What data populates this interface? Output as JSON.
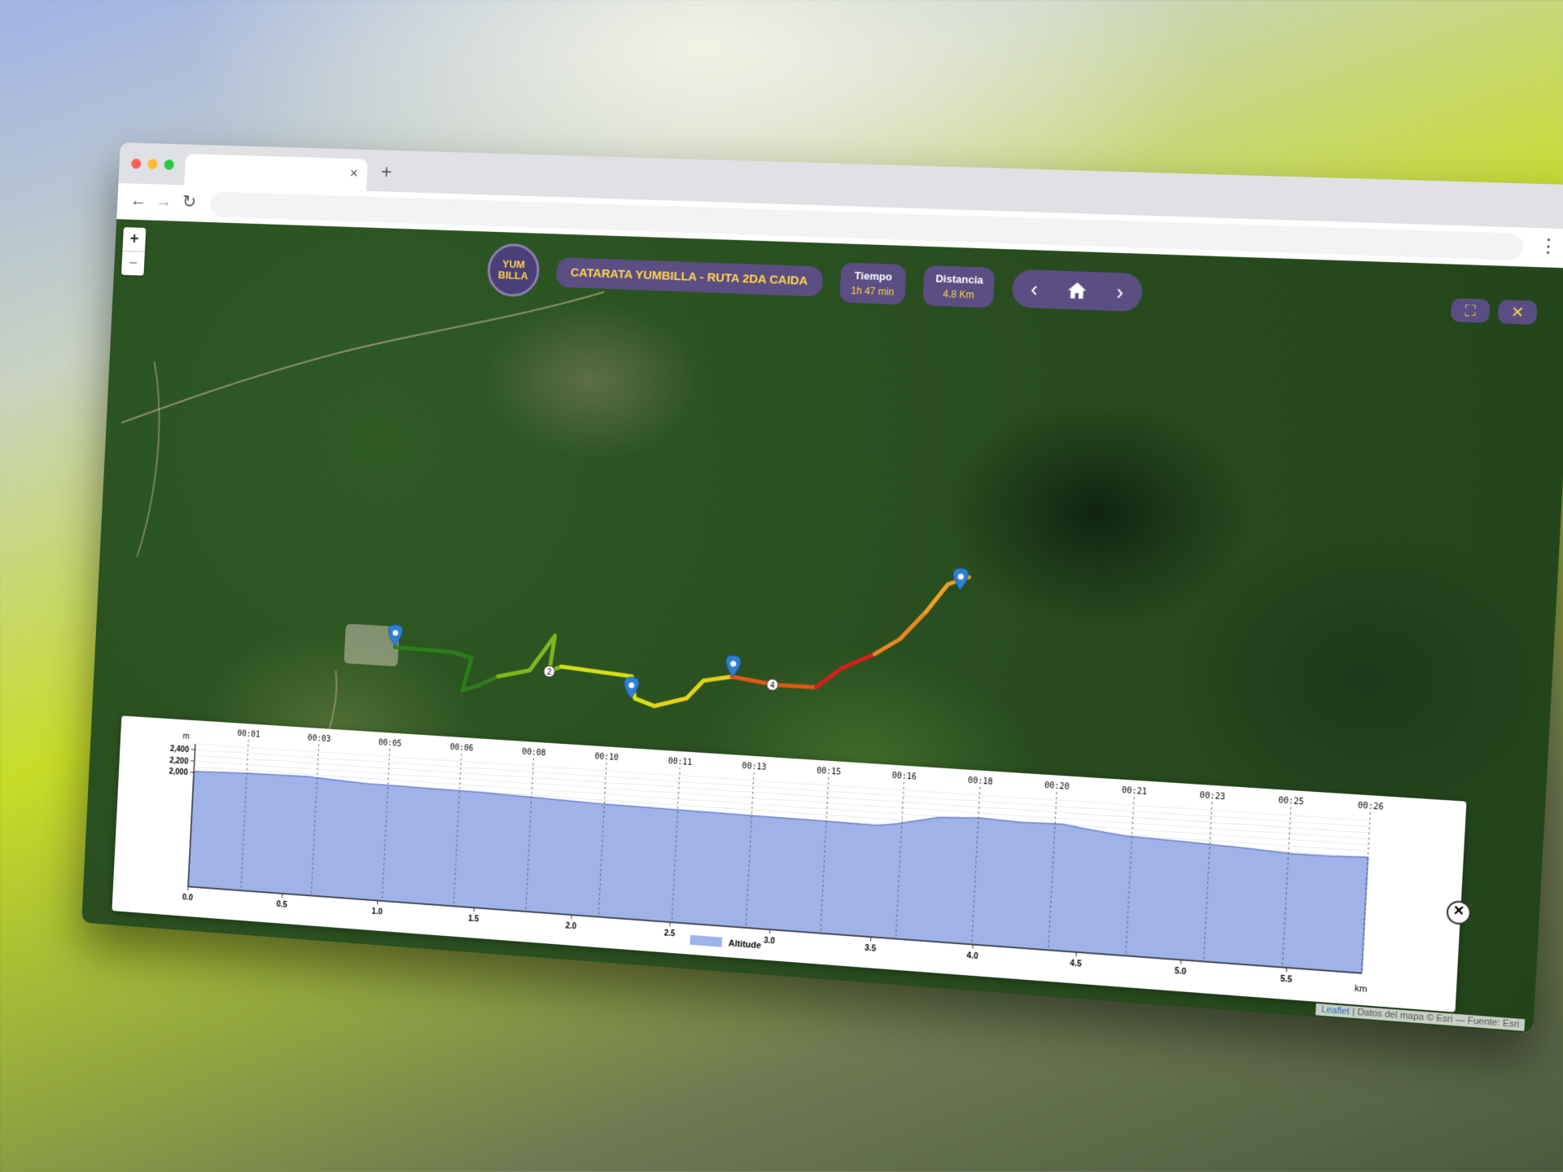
{
  "browser": {
    "tab_close": "×",
    "new_tab": "+",
    "back": "←",
    "forward": "→",
    "reload": "↻",
    "menu": "⋮",
    "address_value": ""
  },
  "map": {
    "zoom_in": "+",
    "zoom_out": "−",
    "logo_text": "YUM BILLA",
    "route_title": "CATARATA YUMBILLA - RUTA 2DA CAIDA",
    "time_label": "Tiempo",
    "time_value": "1h 47 min",
    "distance_label": "Distancia",
    "distance_value": "4.8 Km",
    "prev_icon": "‹",
    "next_icon": "›",
    "fullscreen_icon": "⛶",
    "close_icon": "✕",
    "waypoint_labels": [
      "2",
      "4"
    ],
    "route_colors": [
      "#2e7d1c",
      "#7fb81c",
      "#d6e01a",
      "#e6d21a",
      "#e05a12",
      "#d6201a",
      "#e88a1c",
      "#f0a020"
    ],
    "marker_color": "#2f7fd1",
    "attribution_link": "Leaflet",
    "attribution_text": " | Datos del mapa © Esri — Fuente: Esri"
  },
  "elevation": {
    "close": "✕",
    "y_unit": "m",
    "x_unit": "km",
    "legend": "Altitude",
    "fill_color": "#9fb3e8",
    "line_color": "#6b82c9"
  },
  "chart_data": {
    "type": "area",
    "xlabel": "km",
    "ylabel": "m",
    "x_ticks": [
      "0.0",
      "0.5",
      "1.0",
      "1.5",
      "2.0",
      "2.5",
      "3.0",
      "3.5",
      "4.0",
      "4.5",
      "5.0",
      "5.5"
    ],
    "y_ticks": [
      "2,000",
      "2,200",
      "2,400"
    ],
    "time_ticks": [
      "00:01",
      "00:03",
      "00:05",
      "00:06",
      "00:08",
      "00:10",
      "00:11",
      "00:13",
      "00:15",
      "00:16",
      "00:18",
      "00:20",
      "00:21",
      "00:23",
      "00:25",
      "00:26"
    ],
    "xlim": [
      0,
      5.85
    ],
    "ylim": [
      0,
      2500
    ],
    "series": [
      {
        "name": "Altitude",
        "x": [
          0.0,
          0.3,
          0.6,
          0.9,
          1.2,
          1.5,
          1.8,
          2.1,
          2.4,
          2.7,
          3.0,
          3.3,
          3.5,
          3.6,
          3.8,
          4.0,
          4.2,
          4.4,
          4.5,
          4.7,
          5.0,
          5.3,
          5.5,
          5.7,
          5.85
        ],
        "y": [
          2020,
          2050,
          2060,
          2010,
          2000,
          1990,
          1960,
          1930,
          1920,
          1910,
          1900,
          1890,
          1880,
          1930,
          2080,
          2120,
          2090,
          2110,
          2060,
          1980,
          1950,
          1910,
          1870,
          1880,
          1900
        ]
      }
    ],
    "legend": "bottom-center",
    "grid": true
  }
}
